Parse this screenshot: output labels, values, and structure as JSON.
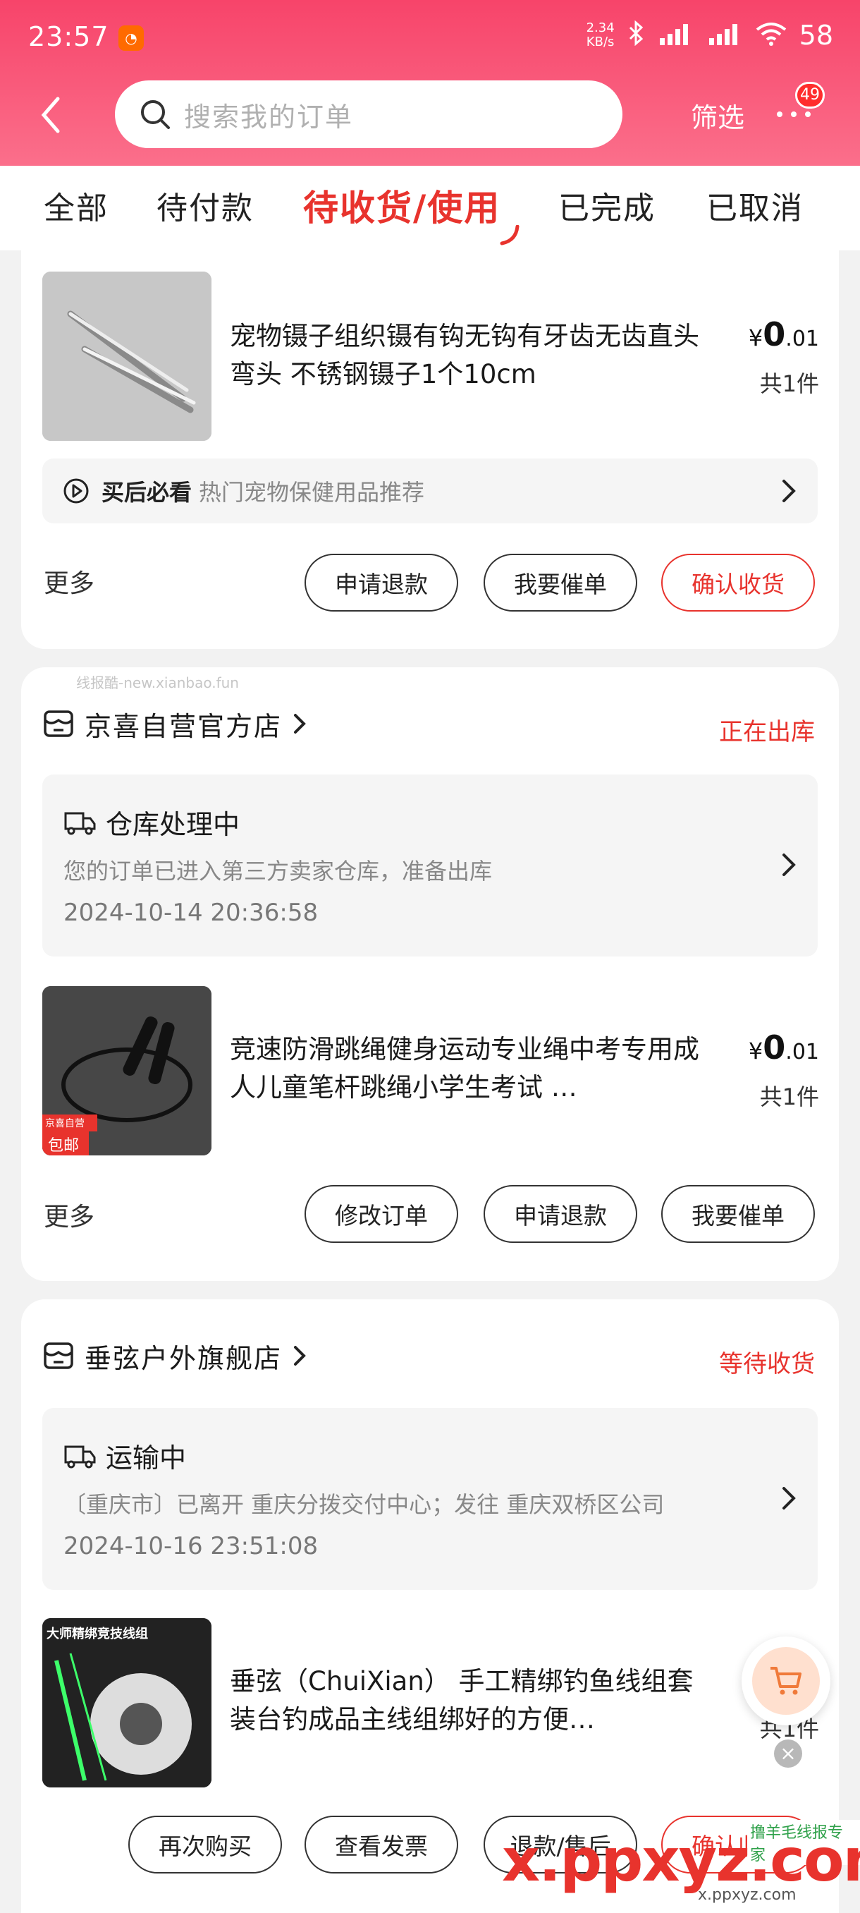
{
  "status_bar": {
    "time": "23:57",
    "net_speed_value": "2.34",
    "net_speed_unit": "KB/s",
    "battery": "58"
  },
  "header": {
    "search_placeholder": "搜索我的订单",
    "filter_label": "筛选",
    "message_count": "49"
  },
  "tabs": [
    {
      "label": "全部"
    },
    {
      "label": "待付款"
    },
    {
      "label": "待收货/使用",
      "active": true
    },
    {
      "label": "已完成"
    },
    {
      "label": "已取消"
    }
  ],
  "order1": {
    "title": "宠物镊子组织镊有钩无钩有牙齿无齿直头弯头 不锈钢镊子1个10cm",
    "price_symbol": "¥",
    "price_int": "0",
    "price_dec": ".01",
    "qty": "共1件",
    "tip_bold": "买后必看",
    "tip_text": "热门宠物保健用品推荐",
    "more_label": "更多",
    "buttons": [
      "申请退款",
      "我要催单",
      "确认收货"
    ]
  },
  "watermark_text": "线报酷-new.xianbao.fun",
  "order2": {
    "shop_name": "京喜自营官方店",
    "status": "正在出库",
    "logistics_title": "仓库处理中",
    "logistics_desc": "您的订单已进入第三方卖家仓库，准备出库",
    "logistics_time": "2024-10-14 20:36:58",
    "title": "竞速防滑跳绳健身运动专业绳中考专用成人儿童笔杆跳绳小学生考试 …",
    "thumb_tag_top": "京喜自营",
    "thumb_tag": "包邮",
    "price_symbol": "¥",
    "price_int": "0",
    "price_dec": ".01",
    "qty": "共1件",
    "more_label": "更多",
    "buttons": [
      "修改订单",
      "申请退款",
      "我要催单"
    ]
  },
  "order3": {
    "shop_name": "垂弦户外旗舰店",
    "status": "等待收货",
    "logistics_title": "运输中",
    "logistics_desc": "〔重庆市〕已离开 重庆分拨交付中心；发往 重庆双桥区公司",
    "logistics_time": "2024-10-16 23:51:08",
    "title": "垂弦（ChuiXian） 手工精绑钓鱼线组套装台钓成品主线组绑好的方便…",
    "thumb_caption": "大师精绑竞技线组",
    "qty": "共1件",
    "buttons": [
      "再次购买",
      "查看发票",
      "退款/售后",
      "确认收货"
    ]
  },
  "overlay_watermark": {
    "big": "x.ppxyz.com",
    "small": "x.ppxyz.com",
    "tag": "撸羊毛线报专家"
  },
  "colors": {
    "accent": "#e8332d",
    "header_top": "#f7446a",
    "header_bottom": "#fb6f8b"
  }
}
